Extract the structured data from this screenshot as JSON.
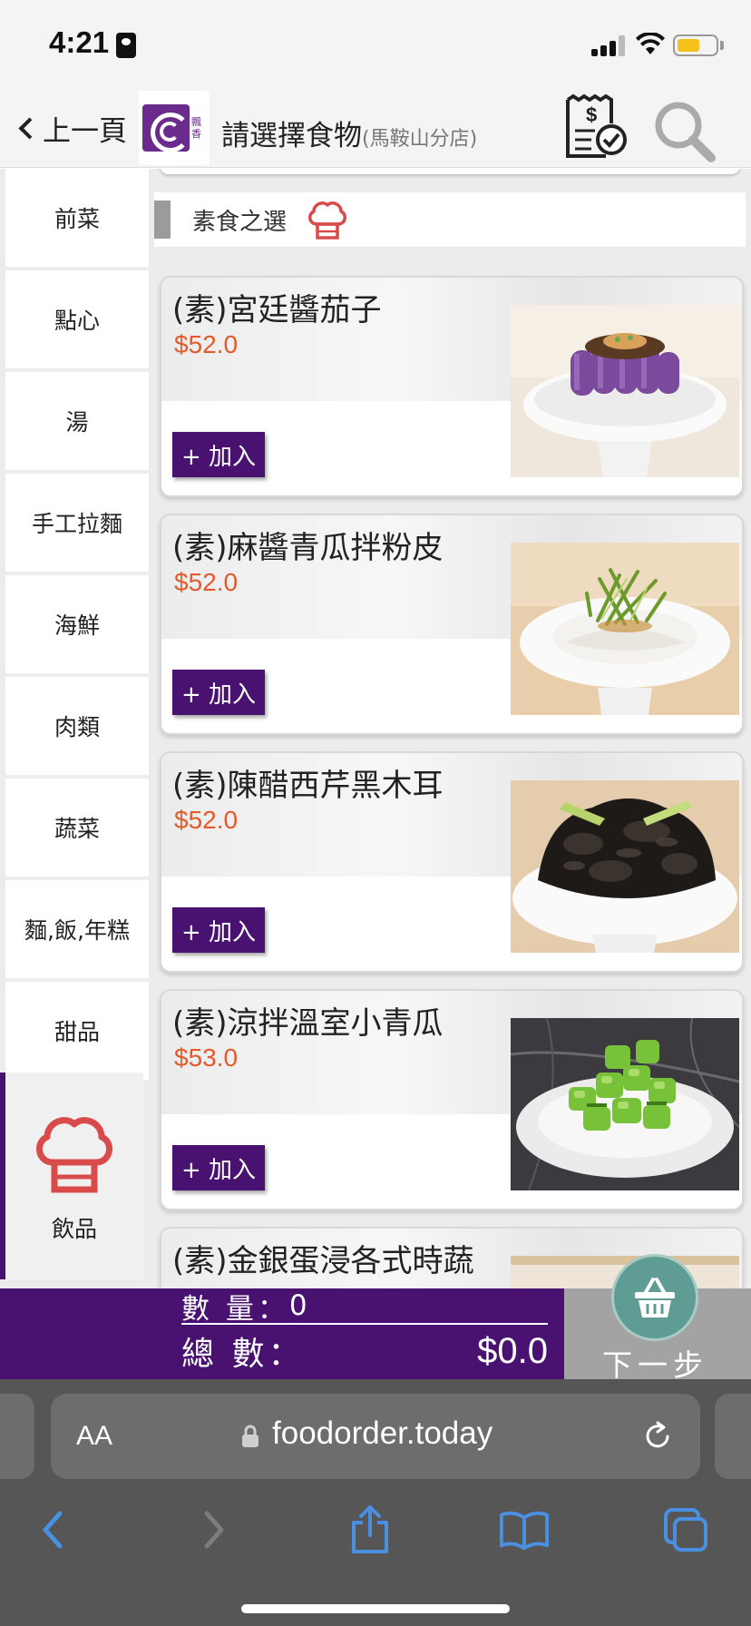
{
  "status_bar": {
    "time": "4:21"
  },
  "header": {
    "back_label": "上一頁",
    "logo_text": "飄香",
    "title": "請選擇食物",
    "branch": "(馬鞍山分店)"
  },
  "sidebar": {
    "items": [
      {
        "label": "前菜"
      },
      {
        "label": "點心"
      },
      {
        "label": "湯"
      },
      {
        "label": "手工拉麵"
      },
      {
        "label": "海鮮"
      },
      {
        "label": "肉類"
      },
      {
        "label": "蔬菜"
      },
      {
        "label": "麵,飯,年糕"
      },
      {
        "label": "甜品"
      },
      {
        "label": "飲品"
      }
    ],
    "active": "飲品"
  },
  "section": {
    "title": "素食之選"
  },
  "dishes": [
    {
      "name": "(素)宮廷醬茄子",
      "price": "$52.0",
      "add_label": "+ 加入"
    },
    {
      "name": "(素)麻醬青瓜拌粉皮",
      "price": "$52.0",
      "add_label": "+ 加入"
    },
    {
      "name": "(素)陳醋西芹黑木耳",
      "price": "$52.0",
      "add_label": "+ 加入"
    },
    {
      "name": "(素)涼拌溫室小青瓜",
      "price": "$53.0",
      "add_label": "+ 加入"
    },
    {
      "name": "(素)金銀蛋浸各式時蔬",
      "price": "",
      "add_label": ""
    }
  ],
  "cart": {
    "qty_label": "數 量：",
    "qty_value": "0",
    "total_label": "總 數：",
    "total_value": "$0.0",
    "next_label": "下一步"
  },
  "browser": {
    "aa_label": "AA",
    "url": "foodorder.today"
  },
  "colors": {
    "brand_purple": "#4a1270",
    "price_orange": "#e55a2b",
    "chef_red": "#d94b4b",
    "ios_blue": "#4a90e2"
  }
}
